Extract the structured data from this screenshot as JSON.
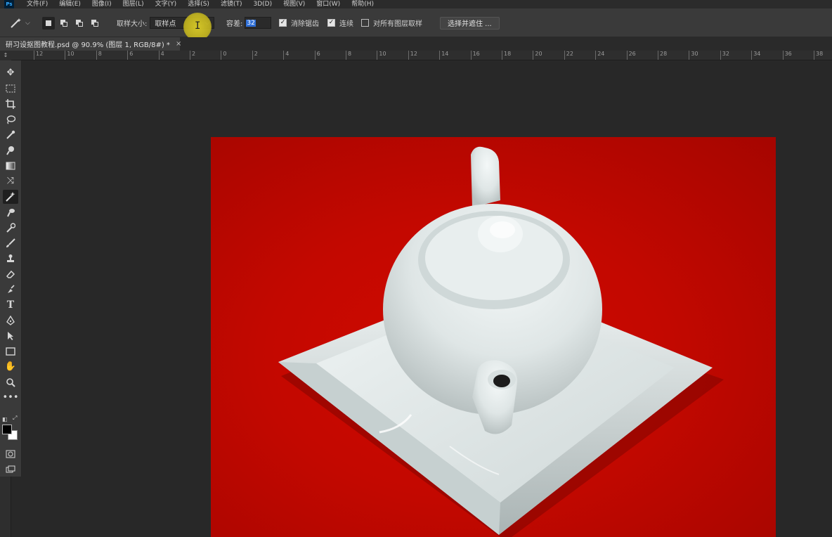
{
  "app": {
    "logo_text": "Ps",
    "menu": [
      "文件(F)",
      "编辑(E)",
      "图像(I)",
      "图层(L)",
      "文字(Y)",
      "选择(S)",
      "滤镜(T)",
      "3D(D)",
      "视图(V)",
      "窗口(W)",
      "帮助(H)"
    ]
  },
  "options": {
    "sample_size_label": "取样大小:",
    "sample_size_value": "取样点",
    "tolerance_label": "容差:",
    "tolerance_value": "32",
    "anti_alias_label": "消除锯齿",
    "anti_alias_checked": true,
    "contiguous_label": "连续",
    "contiguous_checked": true,
    "sample_all_layers_label": "对所有图层取样",
    "sample_all_layers_checked": false,
    "select_mask_label": "选择并遮住 ..."
  },
  "document": {
    "tab_title": "研习设抠图教程.psd @ 90.9% (图层 1, RGB/8#) *",
    "close_glyph": "×"
  },
  "ruler": {
    "corner_glyph": "↕",
    "top_ticks": [
      "12",
      "10",
      "8",
      "6",
      "4",
      "2",
      "0",
      "2",
      "4",
      "6",
      "8",
      "10",
      "12",
      "14",
      "16",
      "18",
      "20",
      "22",
      "24",
      "26",
      "28",
      "30",
      "32",
      "34",
      "36",
      "38"
    ]
  },
  "colors": {
    "app_bg": "#282828",
    "panel_bg": "#3a3a3a",
    "backdrop_red": "#c30800",
    "porcelain": "#e8eeee",
    "selection_blue": "#2f6fd6",
    "cursor_yellow": "#dccd28"
  },
  "toolbar_icons": [
    "move-icon",
    "marquee-icon",
    "crop-icon",
    "lasso-icon",
    "eyedropper-icon",
    "quick-select-icon",
    "gradient-icon",
    "content-aware-move-icon",
    "magic-wand-icon",
    "healing-brush-icon",
    "color-replace-icon",
    "brush-icon",
    "clone-stamp-icon",
    "eraser-icon",
    "history-brush-icon",
    "type-icon",
    "pen-icon",
    "path-select-icon",
    "rectangle-icon",
    "hand-icon",
    "zoom-icon",
    "more-tools-icon"
  ]
}
